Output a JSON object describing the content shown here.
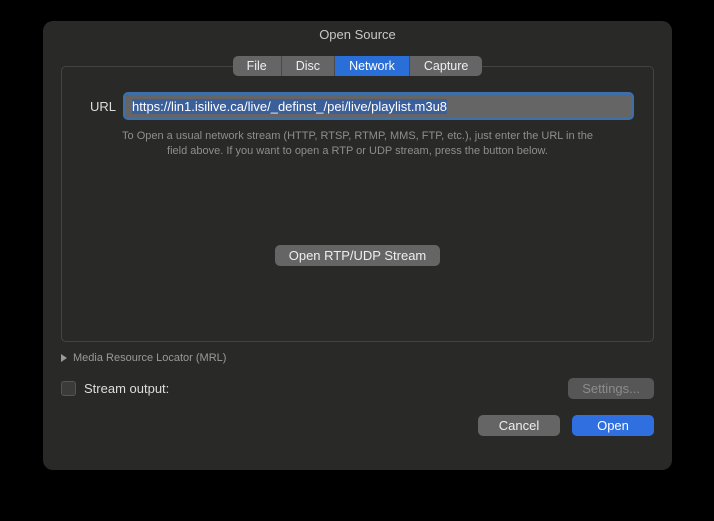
{
  "window": {
    "title": "Open Source"
  },
  "tabs": {
    "file": "File",
    "disc": "Disc",
    "network": "Network",
    "capture": "Capture"
  },
  "network": {
    "url_label": "URL",
    "url_value": "https://lin1.isilive.ca/live/_definst_/pei/live/playlist.m3u8",
    "hint_line1": "To Open a usual network stream (HTTP, RTSP, RTMP, MMS, FTP, etc.), just enter the URL in the",
    "hint_line2": "field above. If you want to open a RTP or UDP stream, press the button below.",
    "rtp_button": "Open RTP/UDP Stream"
  },
  "mrl": {
    "label": "Media Resource Locator (MRL)"
  },
  "stream": {
    "label": "Stream output:",
    "settings": "Settings..."
  },
  "footer": {
    "cancel": "Cancel",
    "open": "Open"
  }
}
